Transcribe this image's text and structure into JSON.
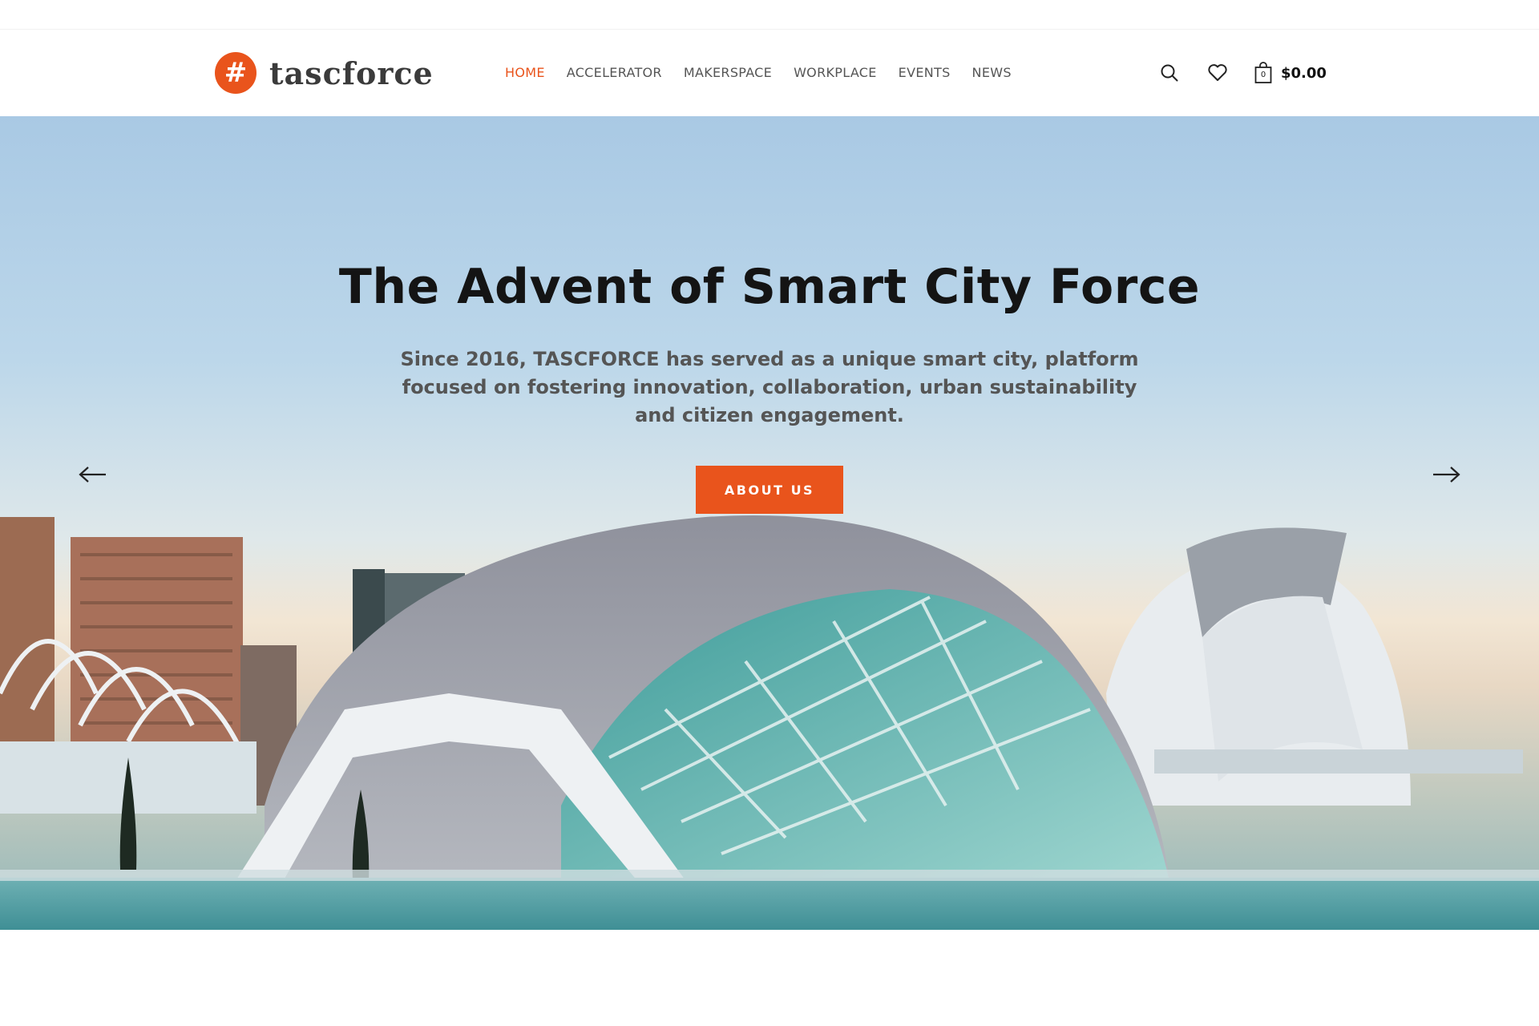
{
  "brand": {
    "logo_mark": "#",
    "name": "tascforce",
    "accent_color": "#e9541c"
  },
  "nav": {
    "items": [
      {
        "label": "HOME",
        "active": true
      },
      {
        "label": "ACCELERATOR",
        "active": false
      },
      {
        "label": "MAKERSPACE",
        "active": false
      },
      {
        "label": "WORKPLACE",
        "active": false
      },
      {
        "label": "EVENTS",
        "active": false
      },
      {
        "label": "NEWS",
        "active": false
      }
    ]
  },
  "tools": {
    "search_icon": "search-icon",
    "wishlist_icon": "heart-icon",
    "cart_icon": "shopping-bag-icon",
    "cart_count": "0",
    "cart_total": "$0.00"
  },
  "hero": {
    "title": "The Advent of Smart City Force",
    "subtitle": "Since 2016, TASCFORCE has served as a unique smart city, platform focused on fostering innovation, collaboration, urban sustainability and citizen engagement.",
    "button_label": "ABOUT US",
    "prev_icon": "arrow-left-icon",
    "next_icon": "arrow-right-icon"
  }
}
